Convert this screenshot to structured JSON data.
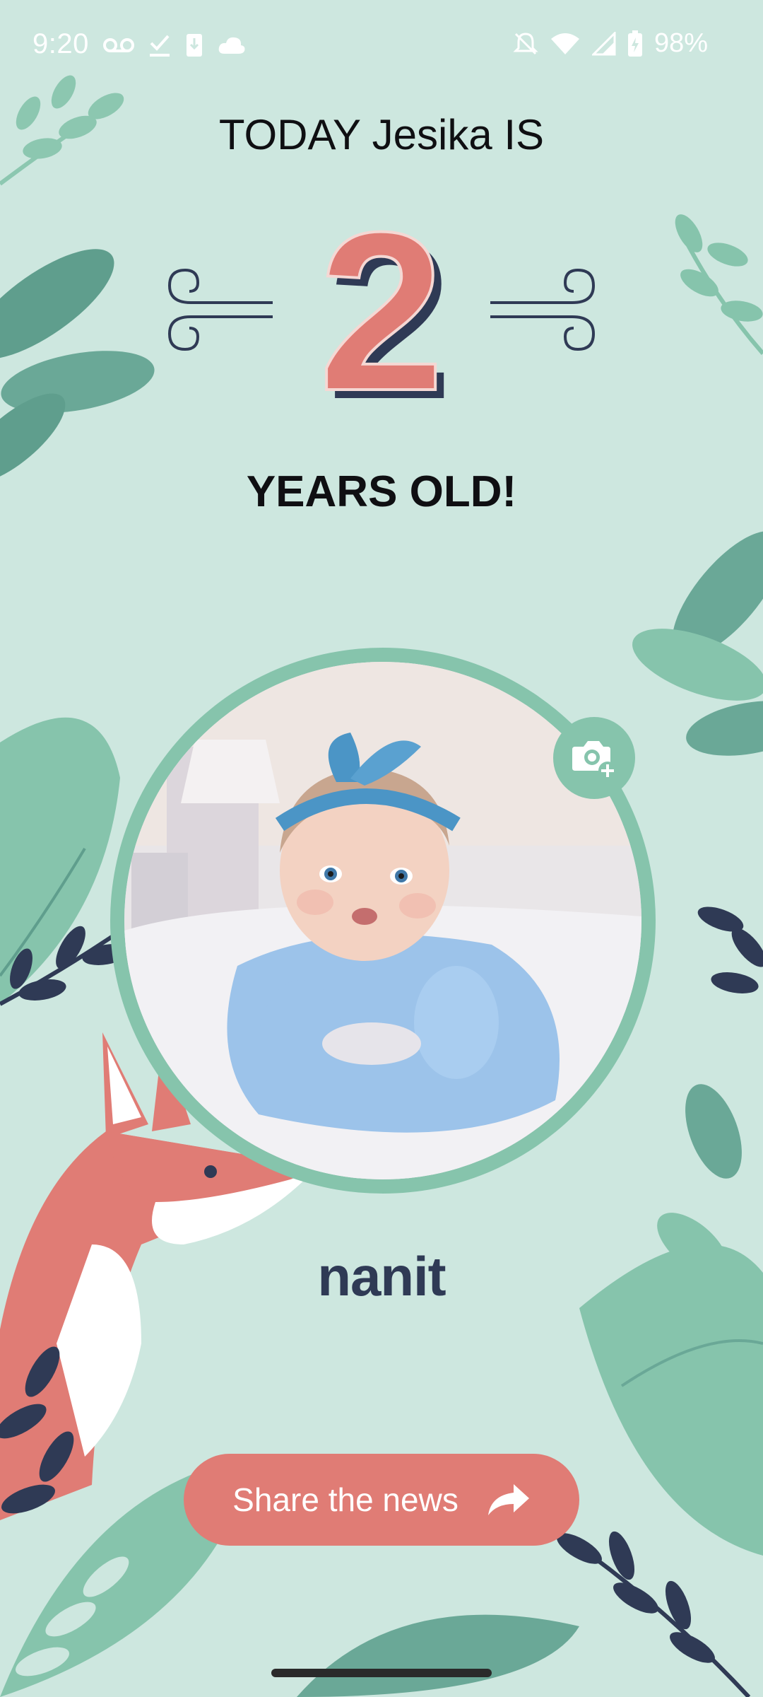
{
  "status_bar": {
    "time": "9:20",
    "battery": "98%",
    "icons": [
      "voicemail-icon",
      "check-icon",
      "download-icon",
      "cloud-icon",
      "notifications-off-icon",
      "wifi-icon",
      "signal-icon",
      "battery-charging-icon"
    ]
  },
  "milestone": {
    "line1": "TODAY Jesika IS",
    "age": "2",
    "line2": "YEARS OLD!"
  },
  "photo": {
    "camera_icon": "add-photo-icon"
  },
  "brand": {
    "logo": "nanit"
  },
  "share": {
    "label": "Share the news",
    "icon": "share-arrow-icon"
  },
  "colors": {
    "background": "#cde7df",
    "accent": "#e07c75",
    "frame": "#86c4ac",
    "navy": "#2f3a55"
  }
}
